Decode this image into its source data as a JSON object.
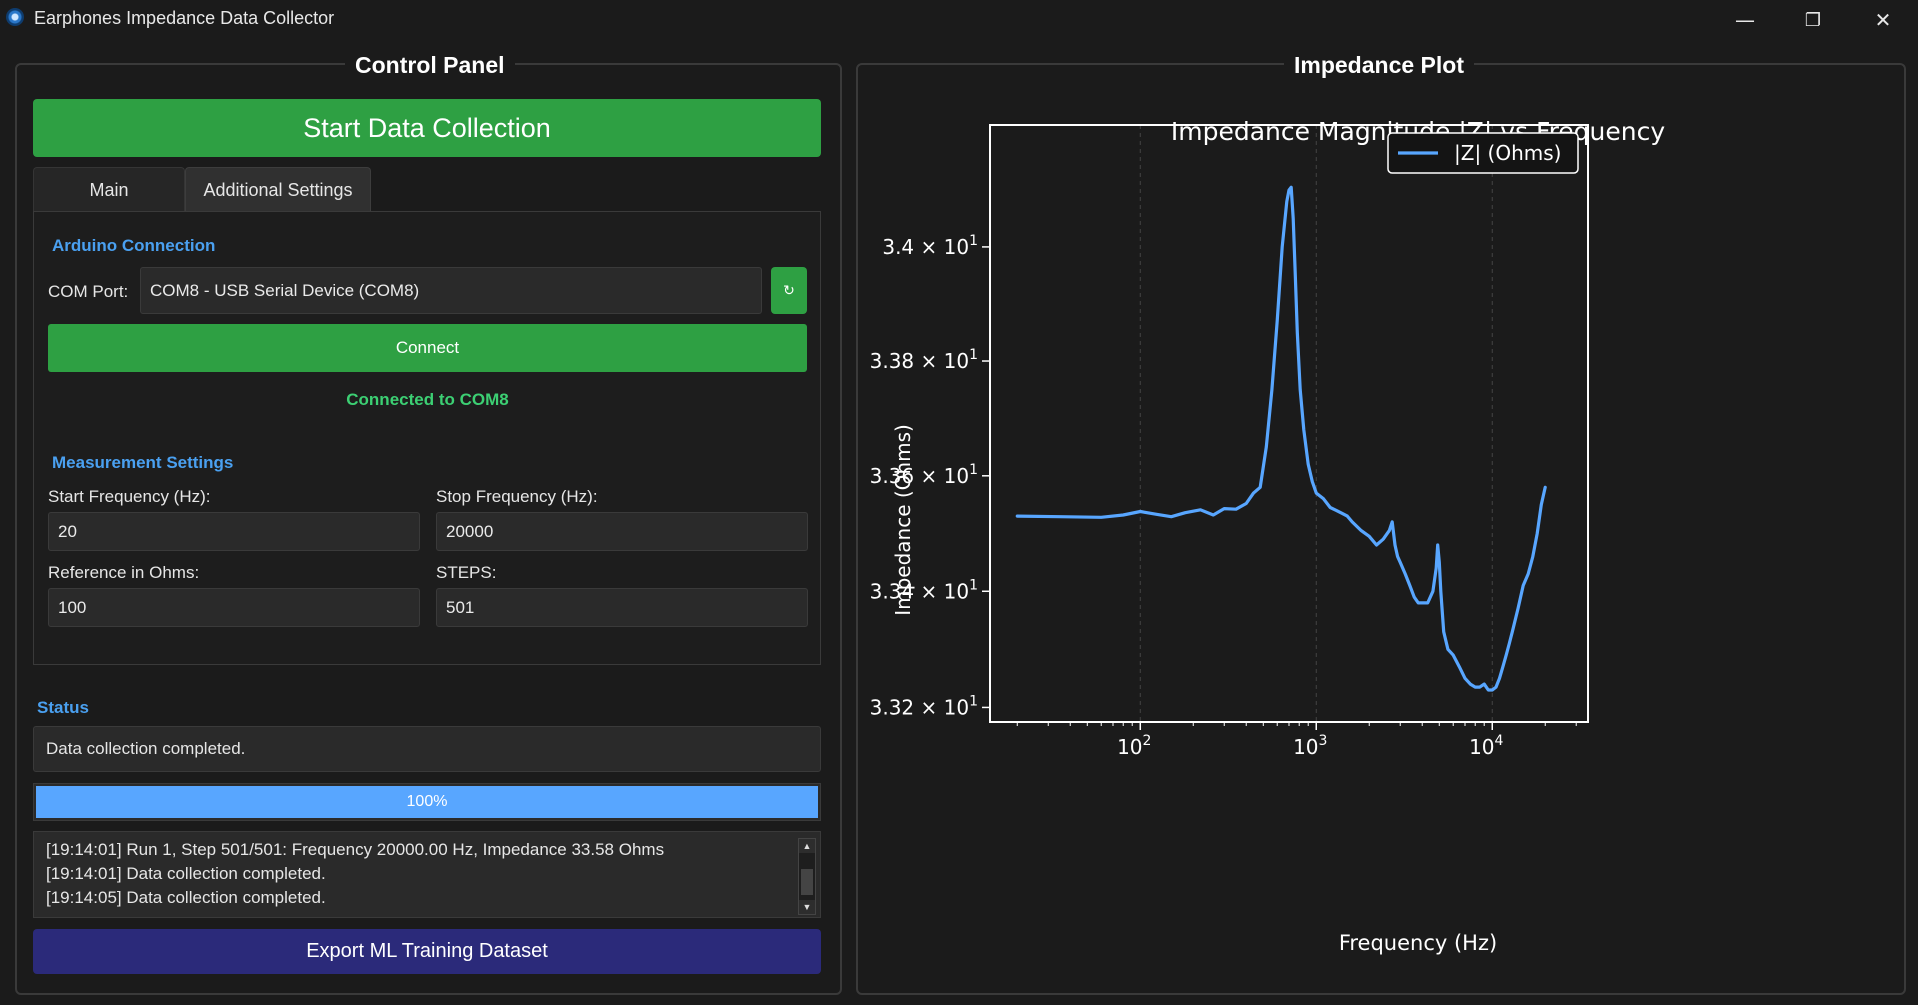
{
  "window": {
    "title": "Earphones Impedance Data Collector",
    "controls": {
      "minimize": "—",
      "maximize": "❐",
      "close": "✕"
    }
  },
  "control_panel": {
    "title": "Control Panel",
    "start_button": "Start Data Collection",
    "tabs": [
      {
        "label": "Main",
        "active": false
      },
      {
        "label": "Additional Settings",
        "active": true
      }
    ],
    "arduino": {
      "heading": "Arduino Connection",
      "com_label": "COM Port:",
      "com_value": "COM8 - USB Serial Device (COM8)",
      "refresh_icon": "↻",
      "connect_button": "Connect",
      "connected_text": "Connected to COM8"
    },
    "measurement": {
      "heading": "Measurement Settings",
      "start_freq_label": "Start Frequency (Hz):",
      "start_freq_value": "20",
      "stop_freq_label": "Stop Frequency (Hz):",
      "stop_freq_value": "20000",
      "reference_label": "Reference in Ohms:",
      "reference_value": "100",
      "steps_label": "STEPS:",
      "steps_value": "501"
    },
    "status": {
      "heading": "Status",
      "message": "Data collection completed.",
      "progress_percent": 100,
      "progress_text": "100%",
      "log": [
        "[19:14:01] Run 1, Step 501/501: Frequency 20000.00 Hz, Impedance 33.58 Ohms",
        "[19:14:01] Data collection completed.",
        "[19:14:05] Data collection completed."
      ]
    },
    "export_button": "Export ML Training Dataset"
  },
  "plot_panel": {
    "title": "Impedance Plot"
  },
  "colors": {
    "accent_green": "#2ea043",
    "connected_green": "#3ccf73",
    "heading_blue": "#4aa0f0",
    "progress_blue": "#58a6ff",
    "export_indigo": "#2b2a7a",
    "series_blue": "#58a6ff"
  },
  "chart_data": {
    "type": "line",
    "title": "Impedance Magnitude |Z| vs Frequency",
    "xlabel": "Frequency (Hz)",
    "ylabel": "Impedance (Ohms)",
    "x_scale": "log",
    "y_scale": "log",
    "xlim": [
      14,
      35000
    ],
    "ylim": [
      33.175,
      34.215
    ],
    "x_ticks": [
      {
        "value": 100,
        "base": "10",
        "exp": "2"
      },
      {
        "value": 1000,
        "base": "10",
        "exp": "3"
      },
      {
        "value": 10000,
        "base": "10",
        "exp": "4"
      }
    ],
    "y_ticks": [
      {
        "value": 34.0,
        "mantissa": "3.4",
        "base": "10",
        "exp": "1"
      },
      {
        "value": 33.8,
        "mantissa": "3.38",
        "base": "10",
        "exp": "1"
      },
      {
        "value": 33.6,
        "mantissa": "3.36",
        "base": "10",
        "exp": "1"
      },
      {
        "value": 33.4,
        "mantissa": "3.34",
        "base": "10",
        "exp": "1"
      },
      {
        "value": 33.2,
        "mantissa": "3.32",
        "base": "10",
        "exp": "1"
      }
    ],
    "grid": "vertical-major",
    "legend_position": "top-right",
    "series": [
      {
        "name": "|Z| (Ohms)",
        "x": [
          20,
          35,
          60,
          80,
          100,
          125,
          150,
          180,
          220,
          260,
          300,
          350,
          400,
          440,
          480,
          520,
          560,
          600,
          640,
          680,
          700,
          720,
          740,
          760,
          780,
          810,
          850,
          900,
          950,
          1000,
          1100,
          1200,
          1300,
          1400,
          1500,
          1600,
          1800,
          2000,
          2200,
          2400,
          2600,
          2700,
          2800,
          2900,
          3000,
          3200,
          3400,
          3600,
          3800,
          4000,
          4300,
          4600,
          4800,
          4900,
          5000,
          5100,
          5300,
          5600,
          6000,
          6500,
          7000,
          7500,
          8000,
          8500,
          9000,
          9500,
          10000,
          10500,
          11000,
          11500,
          12000,
          12500,
          13000,
          14000,
          15000,
          16000,
          17000,
          18000,
          19000,
          20000
        ],
        "y": [
          33.53,
          33.529,
          33.528,
          33.532,
          33.538,
          33.533,
          33.529,
          33.536,
          33.541,
          33.532,
          33.543,
          33.542,
          33.552,
          33.57,
          33.58,
          33.65,
          33.75,
          33.87,
          34.0,
          34.08,
          34.1,
          34.105,
          34.05,
          33.95,
          33.85,
          33.75,
          33.68,
          33.62,
          33.59,
          33.57,
          33.56,
          33.545,
          33.54,
          33.535,
          33.53,
          33.52,
          33.505,
          33.495,
          33.48,
          33.49,
          33.505,
          33.52,
          33.48,
          33.46,
          33.45,
          33.43,
          33.41,
          33.39,
          33.38,
          33.38,
          33.38,
          33.4,
          33.44,
          33.48,
          33.45,
          33.4,
          33.33,
          33.3,
          33.29,
          33.27,
          33.25,
          33.24,
          33.235,
          33.235,
          33.24,
          33.23,
          33.23,
          33.235,
          33.25,
          33.27,
          33.29,
          33.31,
          33.33,
          33.37,
          33.41,
          33.43,
          33.46,
          33.5,
          33.55,
          33.58
        ]
      }
    ]
  }
}
